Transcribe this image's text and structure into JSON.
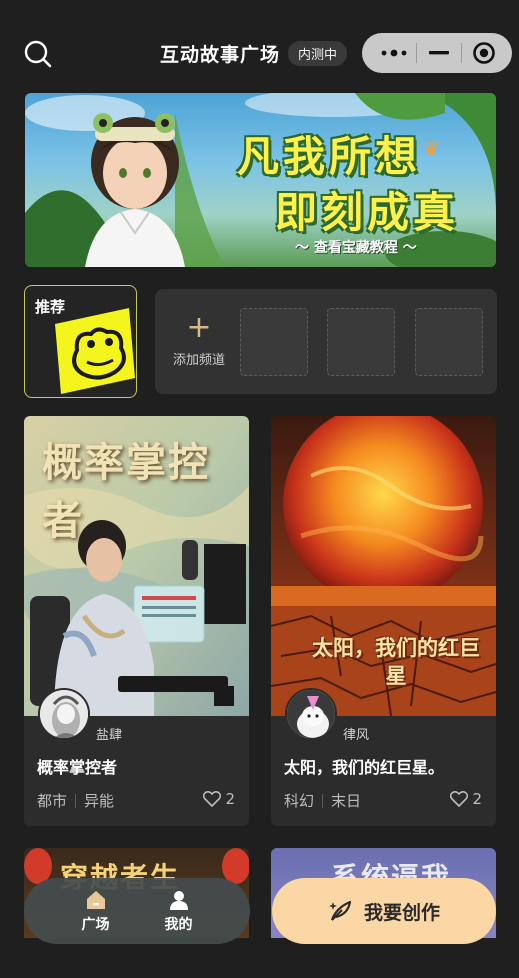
{
  "header": {
    "title": "互动故事广场",
    "badge": "内测中"
  },
  "banner": {
    "line1": "凡我所想",
    "line2": "即刻成真",
    "subtitle": "～ 查看宝藏教程 ～"
  },
  "channels": {
    "recommended_label": "推荐",
    "add_label": "添加频道",
    "add_icon": "+",
    "accent_color": "#c6c95a"
  },
  "stories": [
    {
      "cover_title": "概率掌控者",
      "author": "盐肆",
      "title": "概率掌控者",
      "tags": [
        "都市",
        "异能"
      ],
      "likes": "2"
    },
    {
      "cover_title": "太阳，我们的红巨星",
      "author": "律风",
      "title": "太阳，我们的红巨星。",
      "tags": [
        "科幻",
        "末日"
      ],
      "likes": "2"
    }
  ],
  "peek_cards": [
    {
      "text": "穿越者生"
    },
    {
      "text": "系统逼我"
    }
  ],
  "nav": {
    "home_label": "广场",
    "mine_label": "我的",
    "create_label": "我要创作",
    "create_color": "#fbd7a6"
  },
  "icons": {
    "search": "search-icon",
    "more": "more-dots-icon",
    "minimize": "minimize-icon",
    "close": "target-close-icon",
    "heart": "heart-icon",
    "home": "home-icon",
    "user": "user-icon",
    "feather": "feather-pen-icon"
  }
}
